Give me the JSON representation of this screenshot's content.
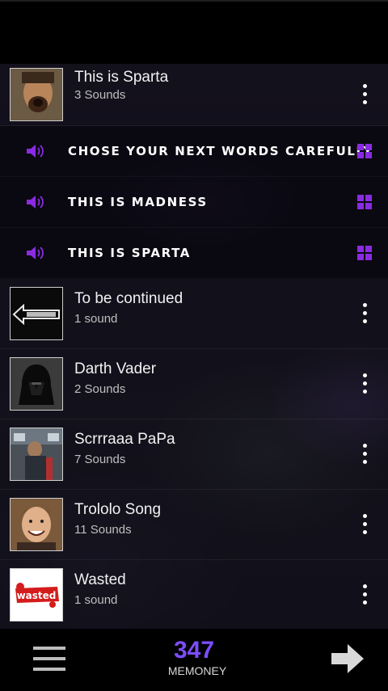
{
  "colors": {
    "accent": "#7c4dff",
    "purple_icons": "#8a2be2"
  },
  "rows_top": [
    {
      "title": "This is Sparta",
      "subtitle": "3 Sounds"
    }
  ],
  "sounds": [
    {
      "title": "CHOSE YOUR NEXT WORDS CAREFULLY"
    },
    {
      "title": "THIS IS MADNESS"
    },
    {
      "title": "THIS IS SPARTA"
    }
  ],
  "rows": [
    {
      "title": "To be continued",
      "subtitle": "1 sound"
    },
    {
      "title": "Darth Vader",
      "subtitle": "2 Sounds"
    },
    {
      "title": "Scrrraaa PaPa",
      "subtitle": "7 Sounds"
    },
    {
      "title": "Trololo Song",
      "subtitle": "11 Sounds"
    },
    {
      "title": "Wasted",
      "subtitle": "1 sound"
    }
  ],
  "footer": {
    "coins": "347",
    "currency_label": "MEMONEY"
  },
  "thumb_texts": {
    "wasted": "wasted"
  },
  "icons": [
    "speaker-icon",
    "grid-icon",
    "more-vert-icon",
    "menu-icon",
    "arrow-right-icon"
  ]
}
